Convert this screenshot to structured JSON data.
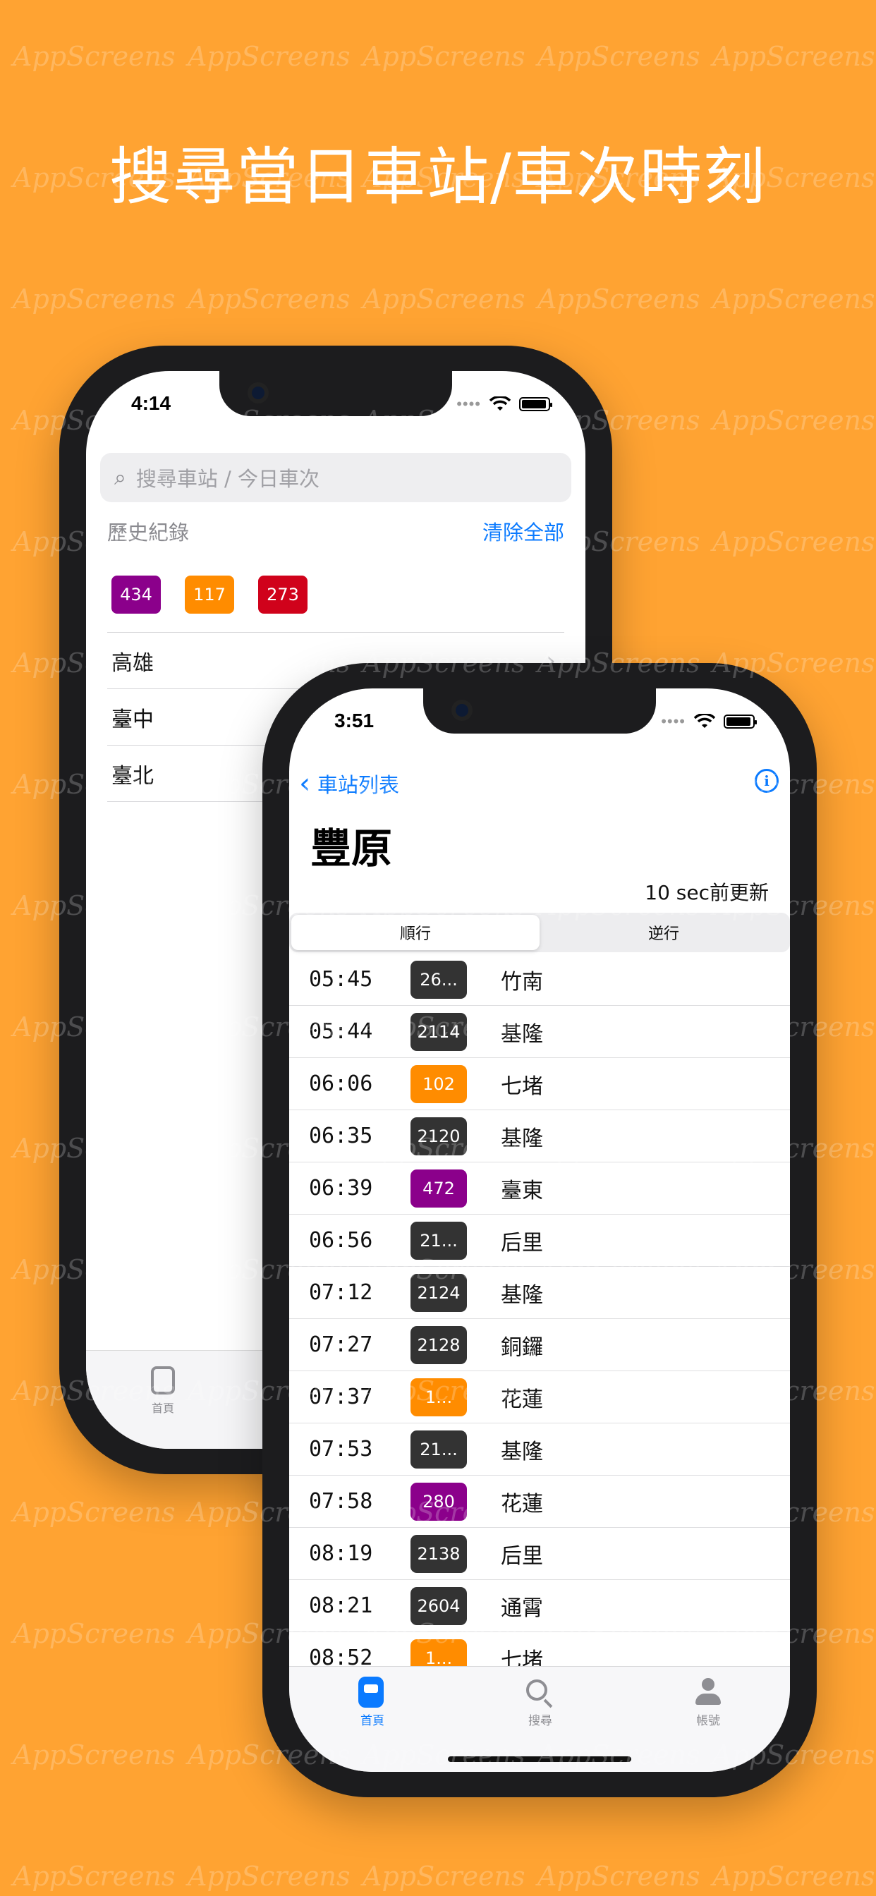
{
  "headline": "搜尋當日車站/車次時刻",
  "watermark": "AppScreens",
  "colors": {
    "background": "#FFA332",
    "accent": "#0A7AFF",
    "train_dark": "#333333",
    "train_orange": "#FF8C00",
    "train_purple": "#8B008B",
    "train_red": "#D0021B"
  },
  "search_screen": {
    "status_time": "4:14",
    "search_placeholder": "搜尋車站 / 今日車次",
    "history_label": "歷史紀錄",
    "clear_all": "清除全部",
    "history_chips": [
      {
        "label": "434",
        "color": "#8B008B"
      },
      {
        "label": "117",
        "color": "#FF8C00"
      },
      {
        "label": "273",
        "color": "#D0021B"
      }
    ],
    "stations": [
      "高雄",
      "臺中",
      "臺北"
    ],
    "tab_home_label": "首頁"
  },
  "station_screen": {
    "status_time": "3:51",
    "back_label": "車站列表",
    "station_name": "豐原",
    "updated": "10 sec前更新",
    "segments": [
      "順行",
      "逆行"
    ],
    "trains": [
      {
        "time": "05:45",
        "train": "26...",
        "color": "#333333",
        "dest": "竹南"
      },
      {
        "time": "05:44",
        "train": "2114",
        "color": "#333333",
        "dest": "基隆"
      },
      {
        "time": "06:06",
        "train": "102",
        "color": "#FF8C00",
        "dest": "七堵"
      },
      {
        "time": "06:35",
        "train": "2120",
        "color": "#333333",
        "dest": "基隆"
      },
      {
        "time": "06:39",
        "train": "472",
        "color": "#8B008B",
        "dest": "臺東"
      },
      {
        "time": "06:56",
        "train": "21...",
        "color": "#333333",
        "dest": "后里"
      },
      {
        "time": "07:12",
        "train": "2124",
        "color": "#333333",
        "dest": "基隆"
      },
      {
        "time": "07:27",
        "train": "2128",
        "color": "#333333",
        "dest": "銅鑼"
      },
      {
        "time": "07:37",
        "train": "1...",
        "color": "#FF8C00",
        "dest": "花蓮"
      },
      {
        "time": "07:53",
        "train": "21...",
        "color": "#333333",
        "dest": "基隆"
      },
      {
        "time": "07:58",
        "train": "280",
        "color": "#8B008B",
        "dest": "花蓮"
      },
      {
        "time": "08:19",
        "train": "2138",
        "color": "#333333",
        "dest": "后里"
      },
      {
        "time": "08:21",
        "train": "2604",
        "color": "#333333",
        "dest": "通霄"
      },
      {
        "time": "08:52",
        "train": "1...",
        "color": "#FF8C00",
        "dest": "七堵"
      }
    ],
    "tabs": [
      {
        "label": "首頁",
        "icon": "train-icon"
      },
      {
        "label": "搜尋",
        "icon": "search-icon"
      },
      {
        "label": "帳號",
        "icon": "person-icon"
      }
    ]
  }
}
